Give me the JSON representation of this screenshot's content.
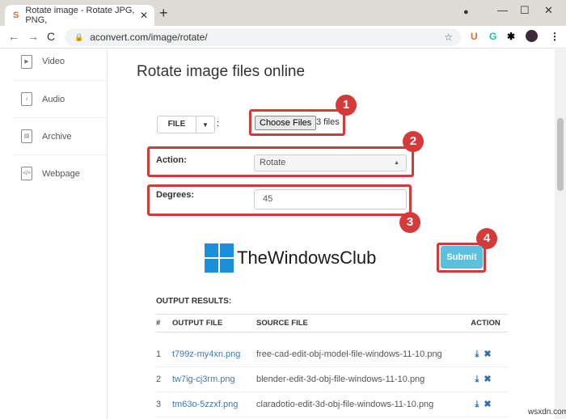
{
  "browser": {
    "tab_title": "Rotate image - Rotate JPG, PNG,",
    "url": "aconvert.com/image/rotate/",
    "extensions": [
      "U",
      "G"
    ]
  },
  "sidebar": {
    "items": [
      {
        "label": "Video"
      },
      {
        "label": "Audio"
      },
      {
        "label": "Archive"
      },
      {
        "label": "Webpage"
      }
    ]
  },
  "page": {
    "title": "Rotate image files online",
    "file_button": "FILE",
    "choose_files": "Choose Files",
    "files_selected": "3 files",
    "action_label": "Action:",
    "action_value": "Rotate",
    "degrees_label": "Degrees:",
    "degrees_value": "45",
    "submit": "Submit",
    "logo_text": "TheWindowsClub",
    "callouts": [
      "1",
      "2",
      "3",
      "4"
    ],
    "highlight_color": "#d33a3a"
  },
  "output": {
    "label": "OUTPUT RESULTS:",
    "headers": [
      "#",
      "OUTPUT FILE",
      "SOURCE FILE",
      "ACTION"
    ],
    "rows": [
      {
        "n": "1",
        "output": "t799z-my4xn.png",
        "source": "free-cad-edit-obj-model-file-windows-11-10.png"
      },
      {
        "n": "2",
        "output": "tw7ig-cj3rm.png",
        "source": "blender-edit-3d-obj-file-windows-11-10.png"
      },
      {
        "n": "3",
        "output": "tm63o-5zzxf.png",
        "source": "claradotio-edit-3d-obj-file-windows-11-10.png"
      }
    ]
  },
  "watermark": "wsxdn.com"
}
